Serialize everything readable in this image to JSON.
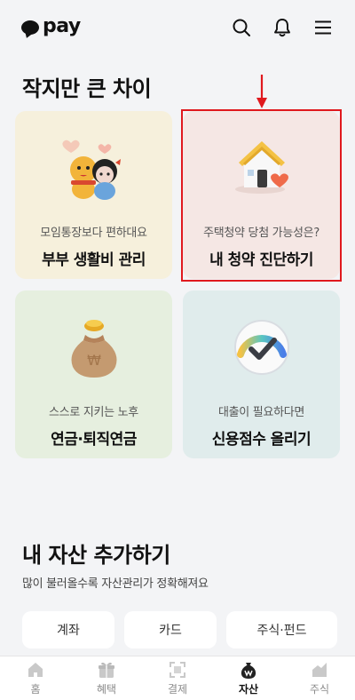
{
  "header": {
    "logo_text": "pay",
    "icons": [
      "search-icon",
      "bell-icon",
      "menu-icon"
    ]
  },
  "section1": {
    "title": "작지만 큰 차이",
    "cards": [
      {
        "subtitle": "모임통장보다 편하대요",
        "title": "부부 생활비 관리",
        "bg": "#f6f0dc",
        "icon": "couple-characters-icon"
      },
      {
        "subtitle": "주택청약 당첨 가능성은?",
        "title": "내 청약 진단하기",
        "bg": "#f5e7e4",
        "icon": "house-heart-icon"
      },
      {
        "subtitle": "스스로 지키는 노후",
        "title": "연금·퇴직연금",
        "bg": "#e6efdf",
        "icon": "money-bag-icon"
      },
      {
        "subtitle": "대출이 필요하다면",
        "title": "신용점수 올리기",
        "bg": "#e0ecec",
        "icon": "gauge-icon"
      }
    ]
  },
  "section2": {
    "title": "내 자산 추가하기",
    "subtitle": "많이 불러올수록 자산관리가 정확해져요",
    "chips": [
      "계좌",
      "카드",
      "주식·펀드"
    ]
  },
  "tabbar": {
    "tabs": [
      {
        "label": "홈",
        "icon": "home-icon",
        "active": false
      },
      {
        "label": "혜택",
        "icon": "gift-icon",
        "active": false
      },
      {
        "label": "결제",
        "icon": "scan-icon",
        "active": false
      },
      {
        "label": "자산",
        "icon": "asset-bag-icon",
        "active": true
      },
      {
        "label": "주식",
        "icon": "stock-icon",
        "active": false
      }
    ]
  },
  "colors": {
    "highlight": "#e0191e",
    "background": "#f3f4f6"
  }
}
